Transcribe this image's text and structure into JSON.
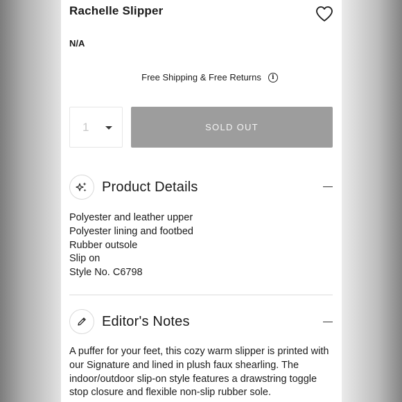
{
  "product": {
    "title": "Rachelle Slipper",
    "price": "N/A"
  },
  "shipping": {
    "text": "Free Shipping & Free Returns",
    "info_icon": "info-icon"
  },
  "purchase": {
    "quantity": "1",
    "sold_out_label": "SOLD OUT"
  },
  "sections": {
    "product_details": {
      "title": "Product Details",
      "icon": "sparkle-icon",
      "items": [
        "Polyester and leather upper",
        "Polyester lining and footbed",
        "Rubber outsole",
        "Slip on",
        "Style No. C6798"
      ]
    },
    "editors_notes": {
      "title": "Editor's Notes",
      "icon": "pencil-icon",
      "body": "A puffer for your feet, this cozy warm slipper is printed with our Signature and lined in plush faux shearling. The indoor/outdoor slip-on style features a drawstring toggle stop closure and flexible non-slip rubber sole."
    }
  },
  "colors": {
    "sold_out_bg": "#9d9d9d",
    "sold_out_text": "#f4f4f4",
    "text": "#1a1a1a"
  }
}
